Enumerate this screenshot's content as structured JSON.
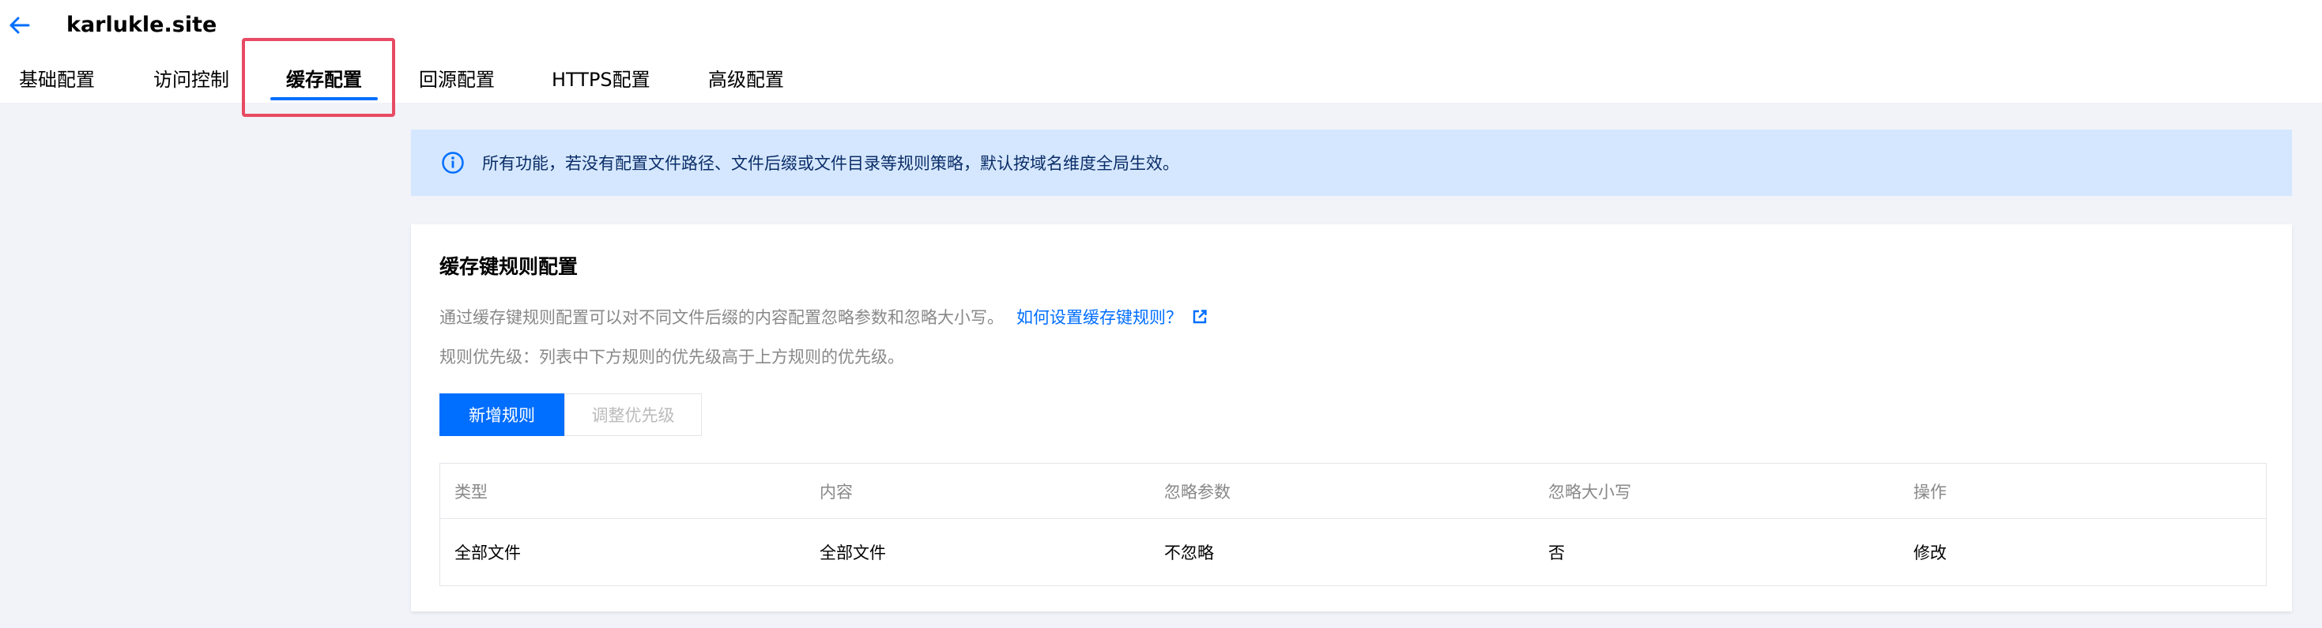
{
  "header": {
    "site_name": "karlukle.site"
  },
  "tabs": [
    {
      "label": "基础配置"
    },
    {
      "label": "访问控制"
    },
    {
      "label": "缓存配置",
      "active": true
    },
    {
      "label": "回源配置"
    },
    {
      "label": "HTTPS配置"
    },
    {
      "label": "高级配置"
    }
  ],
  "notice": {
    "text": "所有功能，若没有配置文件路径、文件后缀或文件目录等规则策略，默认按域名维度全局生效。"
  },
  "cache_key": {
    "title": "缓存键规则配置",
    "description": "通过缓存键规则配置可以对不同文件后缀的内容配置忽略参数和忽略大小写。",
    "help_link": "如何设置缓存键规则？",
    "priority_note": "规则优先级：列表中下方规则的优先级高于上方规则的优先级。",
    "add_button": "新增规则",
    "adjust_button": "调整优先级",
    "columns": [
      "类型",
      "内容",
      "忽略参数",
      "忽略大小写",
      "操作"
    ],
    "rows": [
      {
        "type": "全部文件",
        "content": "全部文件",
        "ignore_params": "不忽略",
        "ignore_case": "否",
        "action": "修改"
      }
    ]
  },
  "colors": {
    "accent": "#006eff",
    "highlight": "#e84a63",
    "notice_bg": "#d5e7fe"
  },
  "icons": {
    "back": "arrow-left-icon",
    "info": "info-icon",
    "external": "external-link-icon"
  }
}
